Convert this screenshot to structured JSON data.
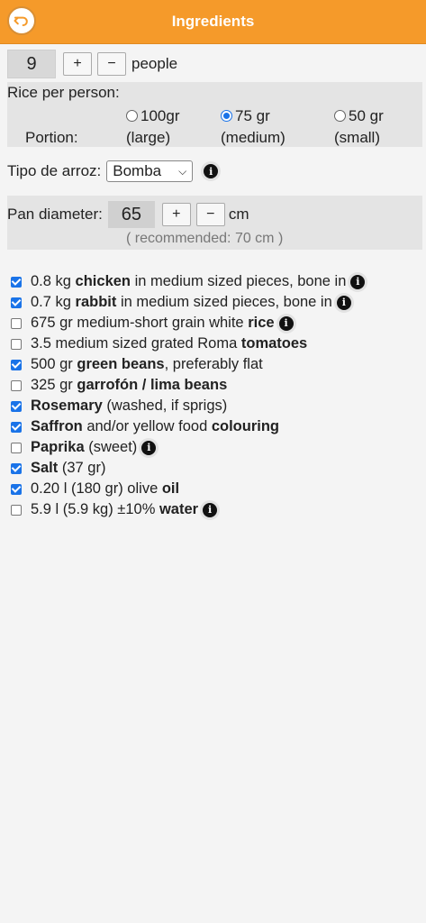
{
  "header": {
    "title": "Ingredients"
  },
  "people": {
    "count": "9",
    "plus": "+",
    "minus": "−",
    "label": "people"
  },
  "rice": {
    "heading": "Rice per person:",
    "portion_label": "Portion:",
    "options": [
      {
        "amount": "100gr",
        "size": "(large)",
        "selected": false
      },
      {
        "amount": "75 gr",
        "size": "(medium)",
        "selected": true
      },
      {
        "amount": "50 gr",
        "size": "(small)",
        "selected": false
      }
    ]
  },
  "rice_type": {
    "label": "Tipo de arroz:",
    "value": "Bomba"
  },
  "pan": {
    "label": "Pan diameter:",
    "value": "65",
    "plus": "+",
    "minus": "−",
    "unit": "cm",
    "recommended": "( recommended:  70 cm )"
  },
  "ingredients": [
    {
      "checked": true,
      "parts": [
        "0.8 kg ",
        "chicken",
        " in medium sized pieces, bone in"
      ],
      "info": true
    },
    {
      "checked": true,
      "parts": [
        "0.7 kg ",
        "rabbit",
        " in medium sized pieces, bone in"
      ],
      "info": true
    },
    {
      "checked": false,
      "parts": [
        "675 gr medium-short grain white ",
        "rice",
        ""
      ],
      "info": true
    },
    {
      "checked": false,
      "parts": [
        "3.5 medium sized grated Roma ",
        "tomatoes",
        ""
      ],
      "info": false
    },
    {
      "checked": true,
      "parts": [
        "500 gr ",
        "green beans",
        ", preferably flat"
      ],
      "info": false
    },
    {
      "checked": false,
      "parts": [
        "325 gr ",
        "garrofón / lima beans",
        ""
      ],
      "info": false
    },
    {
      "checked": true,
      "parts": [
        "",
        "Rosemary",
        " (washed, if sprigs)"
      ],
      "info": false
    },
    {
      "checked": true,
      "parts": [
        "",
        "Saffron",
        " and/or yellow food ",
        "colouring"
      ],
      "info": false
    },
    {
      "checked": false,
      "parts": [
        "",
        "Paprika",
        " (sweet)"
      ],
      "info": true
    },
    {
      "checked": true,
      "parts": [
        "",
        "Salt",
        " (37 gr)"
      ],
      "info": false
    },
    {
      "checked": true,
      "parts": [
        "0.20 l (180 gr) olive ",
        "oil",
        ""
      ],
      "info": false
    },
    {
      "checked": false,
      "parts": [
        "5.9 l (5.9 kg) ±10% ",
        "water",
        ""
      ],
      "info": true
    }
  ],
  "icons": {
    "back": "undo-arrow-icon",
    "info": "info-icon",
    "select": "chevron-down-icon"
  },
  "colors": {
    "header": "#f59a2a",
    "accent": "#1a73e8"
  }
}
